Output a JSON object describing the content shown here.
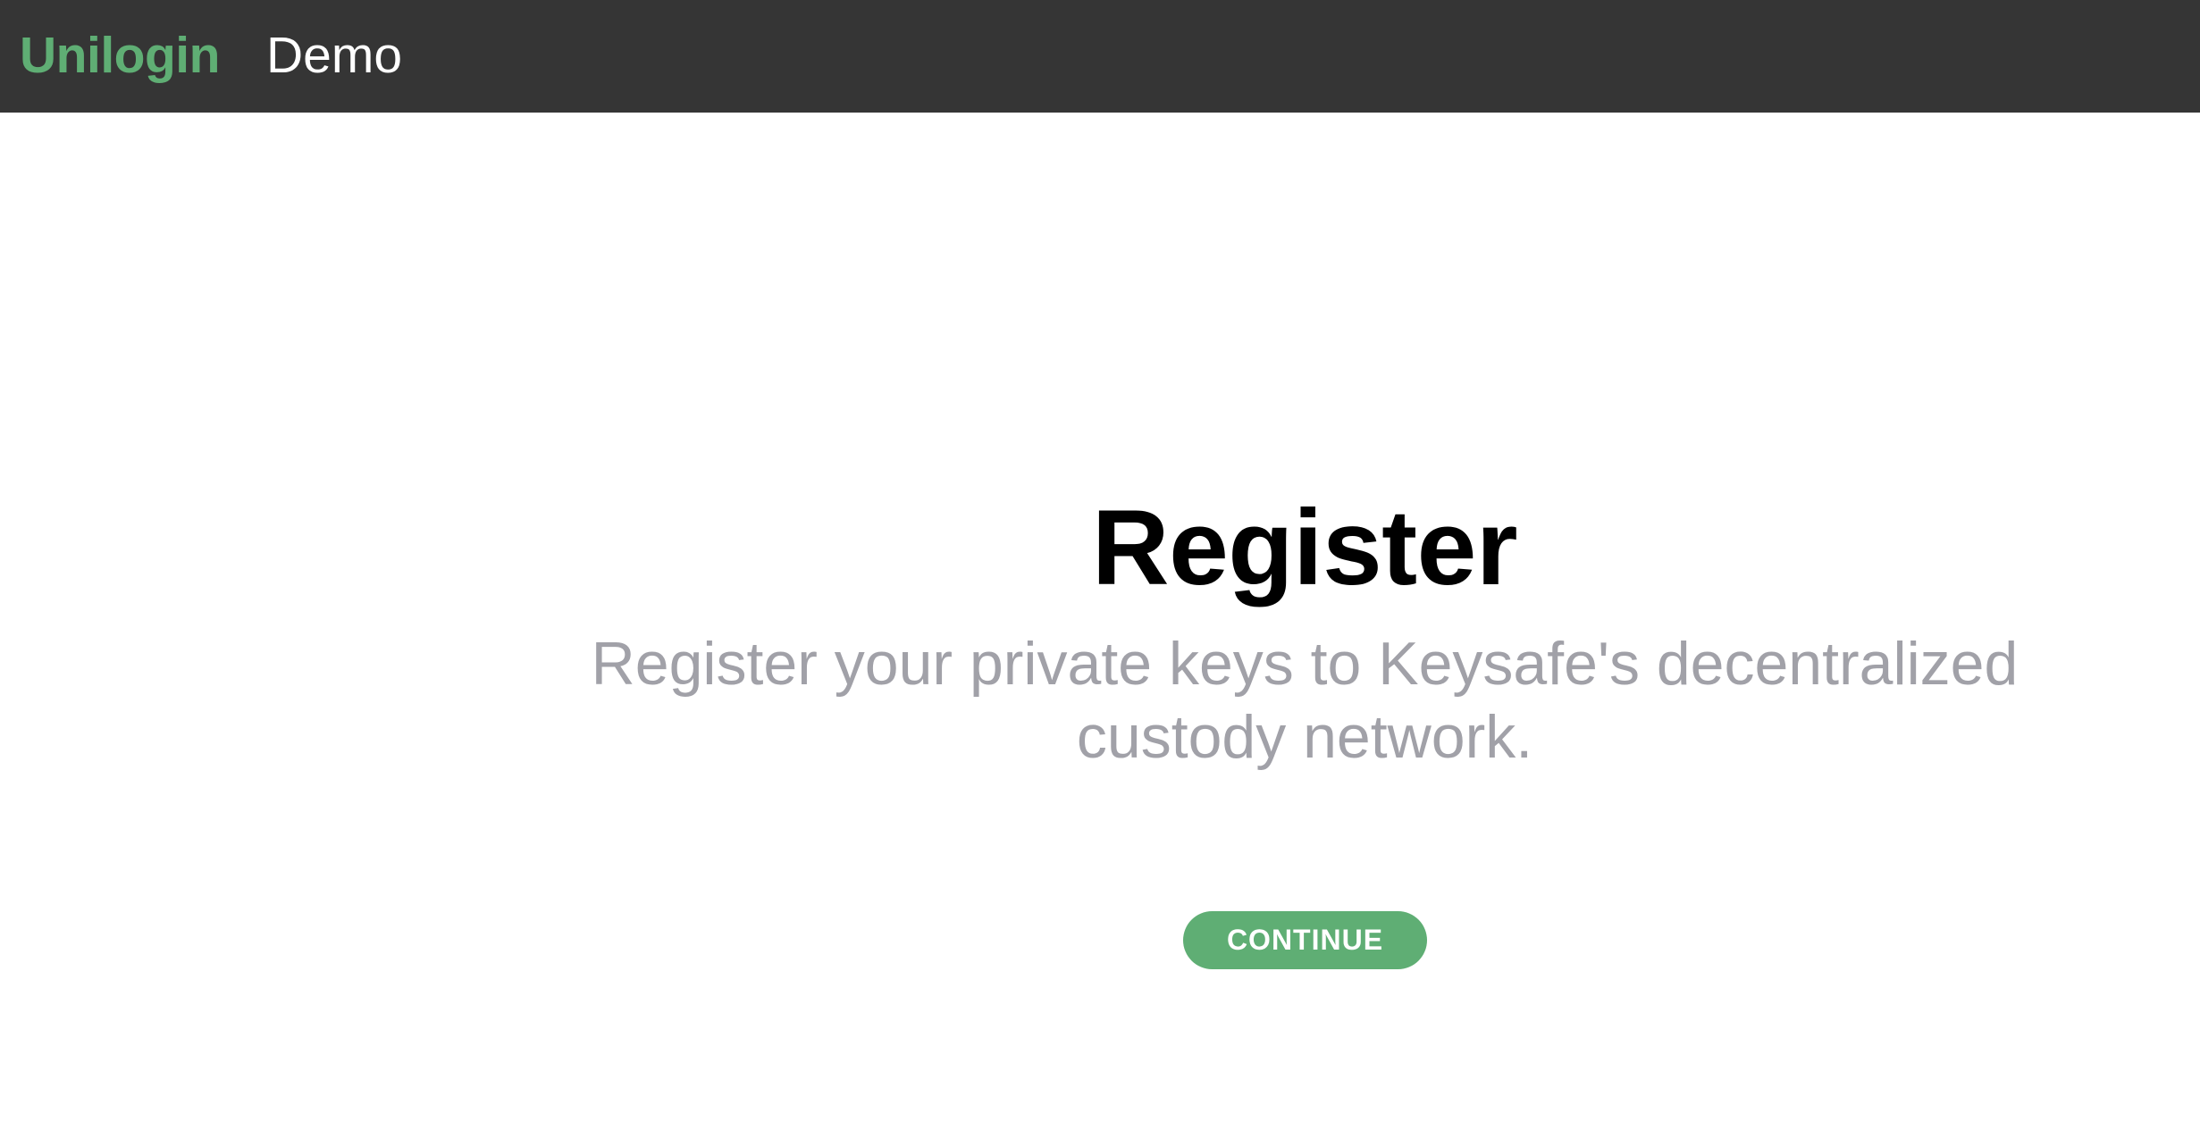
{
  "header": {
    "brand": "Unilogin",
    "brand_suffix": "Demo"
  },
  "main": {
    "title": "Register",
    "subtitle": "Register your private keys to Keysafe's decentralized custody network.",
    "continue_label": "CONTINUE"
  },
  "colors": {
    "header_bg": "#353535",
    "accent": "#5fae74",
    "subtitle": "#a1a1a8"
  }
}
